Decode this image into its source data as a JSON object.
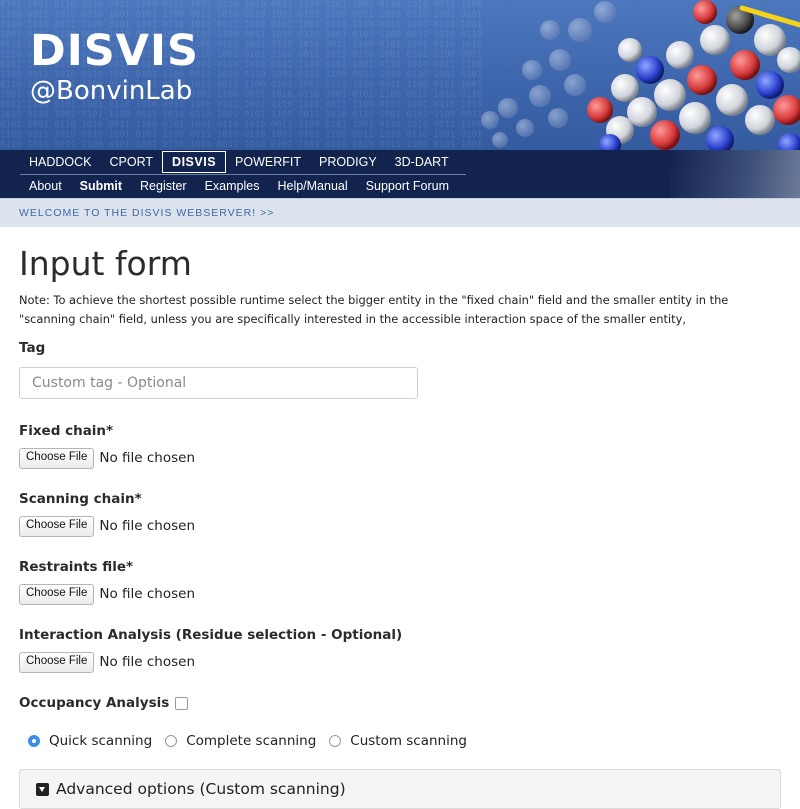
{
  "header": {
    "title": "DISVIS",
    "subtitle": "@BonvinLab"
  },
  "nav": {
    "primary": [
      {
        "label": "HADDOCK",
        "active": false
      },
      {
        "label": "CPORT",
        "active": false
      },
      {
        "label": "DISVIS",
        "active": true
      },
      {
        "label": "POWERFIT",
        "active": false
      },
      {
        "label": "PRODIGY",
        "active": false
      },
      {
        "label": "3D-DART",
        "active": false
      }
    ],
    "secondary": [
      {
        "label": "About"
      },
      {
        "label": "Submit",
        "active": true
      },
      {
        "label": "Register"
      },
      {
        "label": "Examples"
      },
      {
        "label": "Help/Manual"
      },
      {
        "label": "Support Forum"
      }
    ]
  },
  "welcome": "WELCOME TO THE DISVIS WEBSERVER! >>",
  "form": {
    "title": "Input form",
    "note": "Note: To achieve the shortest possible runtime select the bigger entity in the \"fixed chain\" field and the smaller entity in the \"scanning chain\" field, unless you are specifically interested in the accessible interaction space of the smaller entity,",
    "tag_label": "Tag",
    "tag_placeholder": "Custom tag - Optional",
    "tag_value": "",
    "file_fields": [
      {
        "label": "Fixed chain*",
        "button": "Choose File",
        "status": "No file chosen"
      },
      {
        "label": "Scanning chain*",
        "button": "Choose File",
        "status": "No file chosen"
      },
      {
        "label": "Restraints file*",
        "button": "Choose File",
        "status": "No file chosen"
      },
      {
        "label": "Interaction Analysis (Residue selection - Optional)",
        "button": "Choose File",
        "status": "No file chosen"
      }
    ],
    "occupancy_label": "Occupancy Analysis",
    "occupancy_checked": false,
    "scan_options": [
      {
        "label": "Quick scanning",
        "checked": true
      },
      {
        "label": "Complete scanning",
        "checked": false
      },
      {
        "label": "Custom scanning",
        "checked": false
      }
    ],
    "advanced_label": "Advanced options (Custom scanning)"
  },
  "colors": {
    "banner": "#4471b6",
    "nav_bg": "#12244d",
    "welcome_bg": "#dde3ec",
    "welcome_text": "#3a6aa6",
    "radio_accent": "#3b8de6"
  }
}
